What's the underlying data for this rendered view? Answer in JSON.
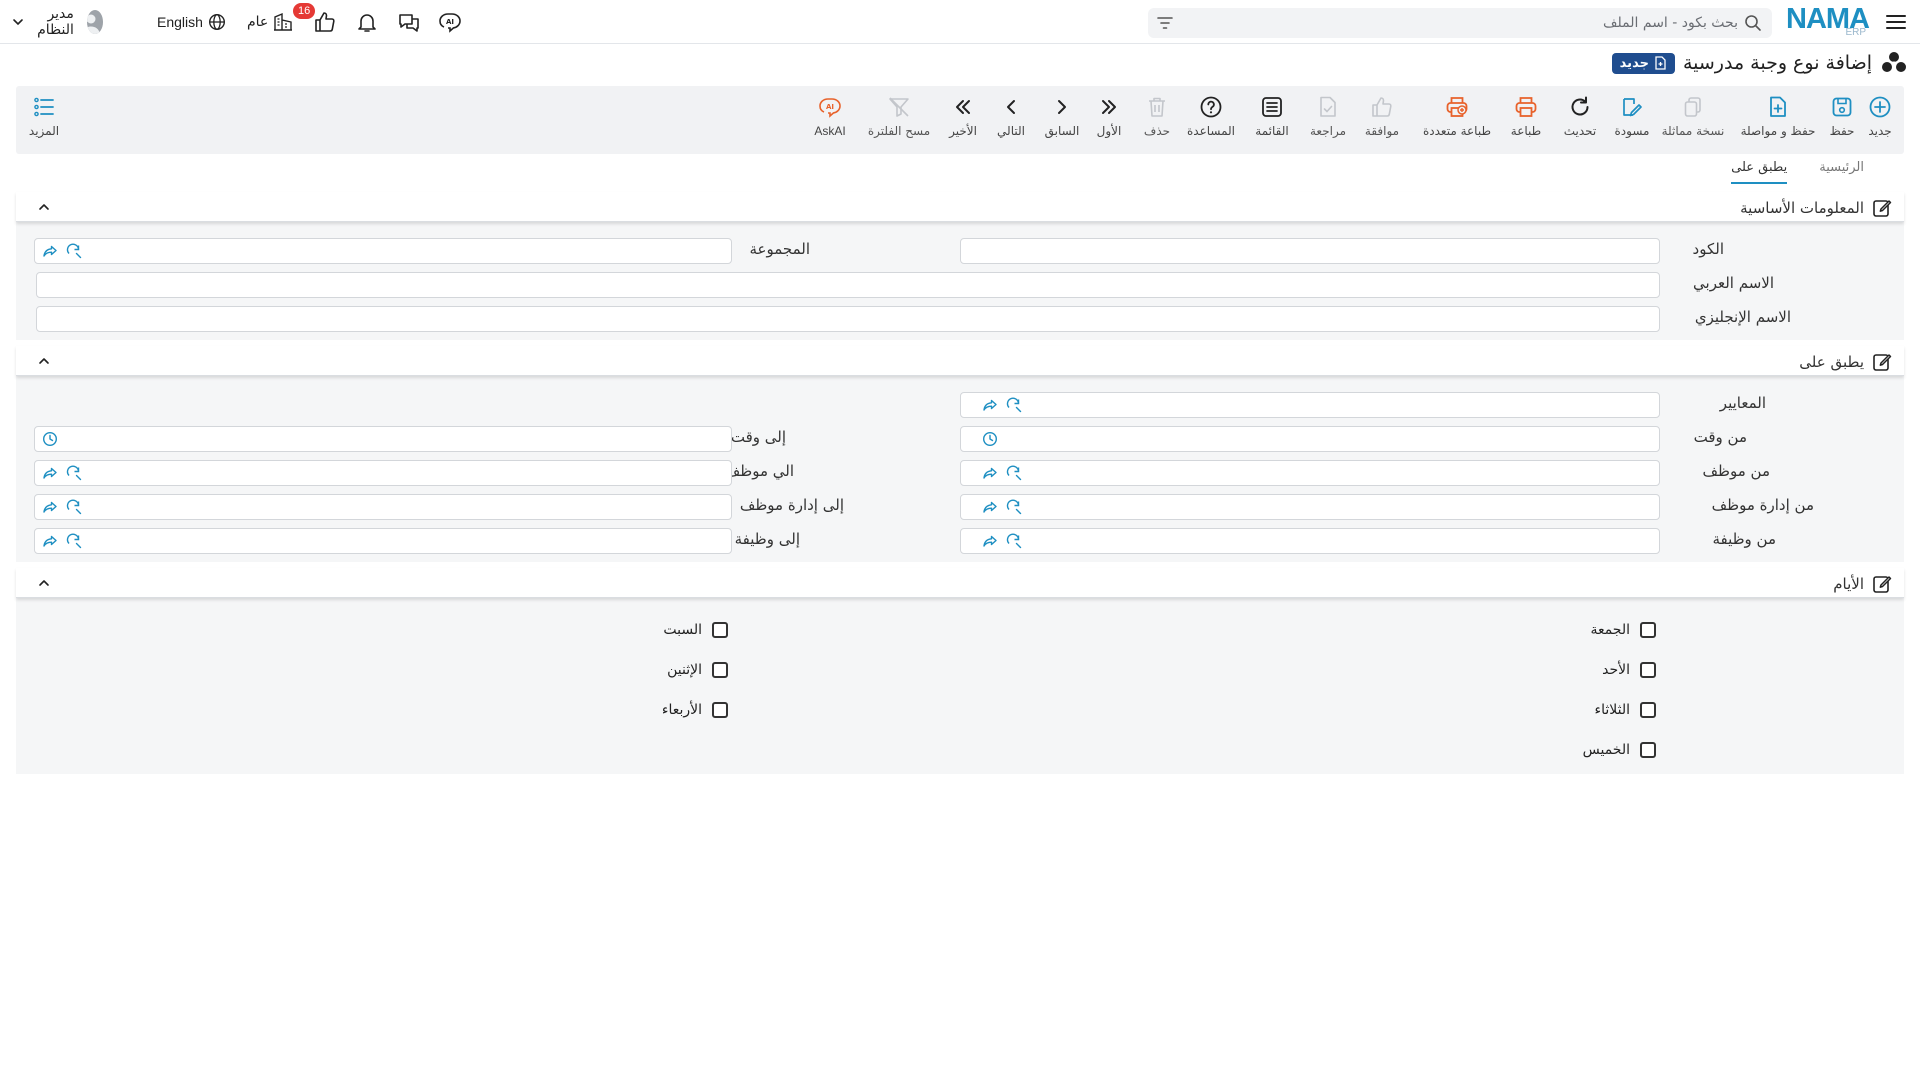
{
  "topbar": {
    "logo_text": "NAMA",
    "logo_sub": "ERP",
    "search_placeholder": "بحث بكود - اسم الملف",
    "notification_count": "16",
    "branch_label": "عام",
    "language_label": "English",
    "user_label": "مدير النظام"
  },
  "page": {
    "title": "إضافة نوع وجبة مدرسية",
    "status_badge": "جديد"
  },
  "toolbar": {
    "new": "جديد",
    "save": "حفظ",
    "save_continue": "حفظ و مواصلة",
    "duplicate": "نسخة مماثلة",
    "draft": "مسودة",
    "refresh": "تحديث",
    "print": "طباعة",
    "multi_print": "طباعة متعددة",
    "approve": "موافقة",
    "review": "مراجعة",
    "list": "القائمة",
    "help": "المساعدة",
    "delete": "حذف",
    "first": "الأول",
    "previous": "السابق",
    "next": "التالي",
    "last": "الأخير",
    "clear_filter": "مسح الفلترة",
    "askai": "AskAI",
    "more": "المزيد"
  },
  "tabs": [
    {
      "label": "الرئيسية",
      "active": false
    },
    {
      "label": "يطبق على",
      "active": true
    }
  ],
  "basic_info": {
    "title": "المعلومات الأساسية",
    "code_label": "الكود",
    "code_value": "",
    "group_label": "المجموعة",
    "group_value": "",
    "arabic_name_label": "الاسم العربي",
    "arabic_name_value": "",
    "english_name_label": "الاسم الإنجليزي",
    "english_name_value": ""
  },
  "applies_to": {
    "title": "يطبق على",
    "criteria_label": "المعايير",
    "from_time_label": "من وقت",
    "to_time_label": "إلى وقت",
    "from_employee_label": "من موظف",
    "to_employee_label": "الي موظف",
    "from_department_label": "من إدارة موظف",
    "to_department_label": "إلى إدارة موظف",
    "from_job_label": "من وظيفة",
    "to_job_label": "إلى وظيفة"
  },
  "days": {
    "title": "الأيام",
    "friday": "الجمعة",
    "sunday": "الأحد",
    "tuesday": "الثلاثاء",
    "thursday": "الخميس",
    "saturday": "السبت",
    "monday": "الإثنين",
    "wednesday": "الأربعاء"
  },
  "colors": {
    "accent": "#1e8fc2",
    "badge_bg": "#1f4d8f",
    "print_orange": "#e8622b",
    "notification_red": "#e53935"
  }
}
